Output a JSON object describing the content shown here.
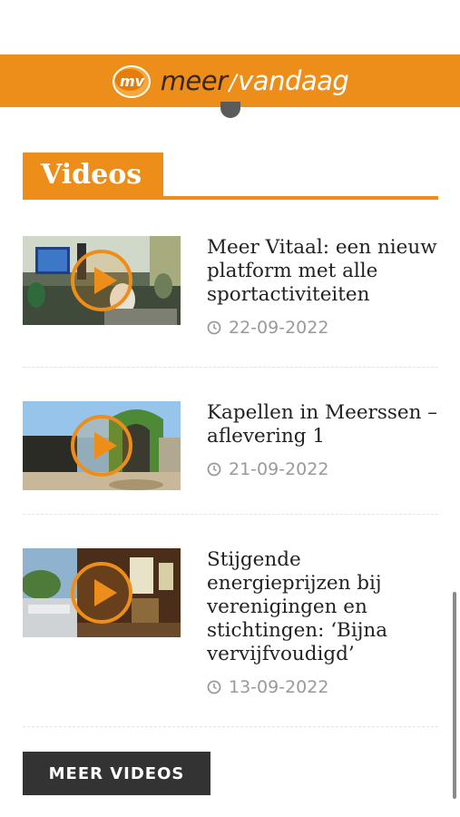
{
  "header": {
    "brand_part1": "meer",
    "brand_slash": "/",
    "brand_part2": "vandaag",
    "logo_text": "mv",
    "accent_color": "#ee8e1a"
  },
  "section": {
    "title": "Videos"
  },
  "videos": [
    {
      "title": "Meer Vitaal: een nieuw platform met alle sportactiviteiten",
      "date": "22-09-2022"
    },
    {
      "title": "Kapellen in Meerssen – aflevering 1",
      "date": "21-09-2022"
    },
    {
      "title": "Stijgende energieprijzen bij verenigingen en stichtingen: ‘Bijna vervijfvoudigd’",
      "date": "13-09-2022"
    }
  ],
  "more_button": {
    "label": "MEER VIDEOS"
  },
  "icons": {
    "clock": "clock-icon",
    "play": "play-icon"
  }
}
